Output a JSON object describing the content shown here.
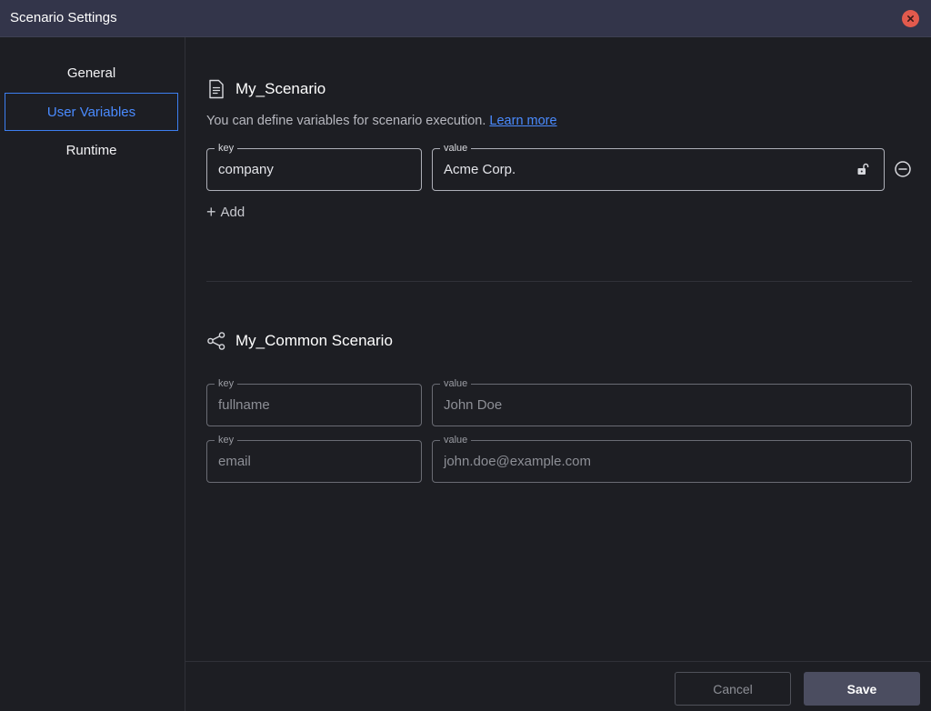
{
  "window": {
    "title": "Scenario Settings",
    "close_icon": "close-icon"
  },
  "sidebar": {
    "items": [
      {
        "label": "General",
        "active": false
      },
      {
        "label": "User Variables",
        "active": true
      },
      {
        "label": "Runtime",
        "active": false
      }
    ]
  },
  "sections": {
    "my_scenario": {
      "icon": "document-icon",
      "name": "My_Scenario",
      "description": "You can define variables for scenario execution.",
      "learn_more": "Learn more",
      "variables": [
        {
          "key_label": "key",
          "key": "company",
          "value_label": "value",
          "value": "Acme Corp.",
          "lock_icon": "unlock-icon"
        }
      ],
      "add_label": "Add"
    },
    "common_scenario": {
      "icon": "share-icon",
      "name": "My_Common Scenario",
      "variables": [
        {
          "key_label": "key",
          "key": "fullname",
          "value_label": "value",
          "value": "John Doe"
        },
        {
          "key_label": "key",
          "key": "email",
          "value_label": "value",
          "value": "john.doe@example.com"
        }
      ]
    }
  },
  "footer": {
    "cancel_label": "Cancel",
    "save_label": "Save"
  },
  "colors": {
    "accent": "#4a8bff",
    "close": "#e25a4d",
    "save_bg": "#4b4d60",
    "titlebar": "#33354a",
    "background": "#1d1e23"
  }
}
